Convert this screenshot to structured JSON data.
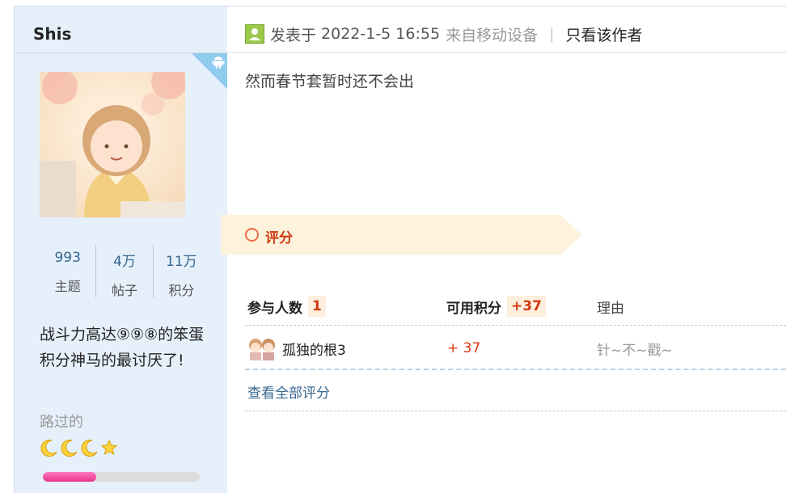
{
  "user": {
    "name": "Shis",
    "stats": [
      {
        "value": "993",
        "label": "主题"
      },
      {
        "value": "4万",
        "label": "帖子"
      },
      {
        "value": "11万",
        "label": "积分"
      }
    ],
    "signature": "战斗力高达⑨⑨⑧的笨蛋积分神马的最讨厌了!",
    "rank": "路过的",
    "level_icons": [
      "moon-icon",
      "moon-icon",
      "moon-icon",
      "star-icon"
    ],
    "level_progress": 0.34
  },
  "post": {
    "posted_prefix": "发表于",
    "posted_time": "2022-1-5 16:55",
    "device": "来自移动设备",
    "separator": "|",
    "only_author": "只看该作者",
    "content": "然而春节套暂时还不会出"
  },
  "rating": {
    "title": "评分",
    "participants_label": "参与人数",
    "participants_count": "1",
    "points_label": "可用积分",
    "points_total": "+37",
    "reason_label": "理由",
    "entries": [
      {
        "user": "孤独的根3",
        "points": "+ 37",
        "reason": "针~不~戳~"
      }
    ],
    "view_all": "查看全部评分"
  },
  "colors": {
    "sidebar_bg": "#e6f0fb",
    "link": "#36668f",
    "accent_red": "#d03a10",
    "banner_bg": "#fdf2dc"
  }
}
